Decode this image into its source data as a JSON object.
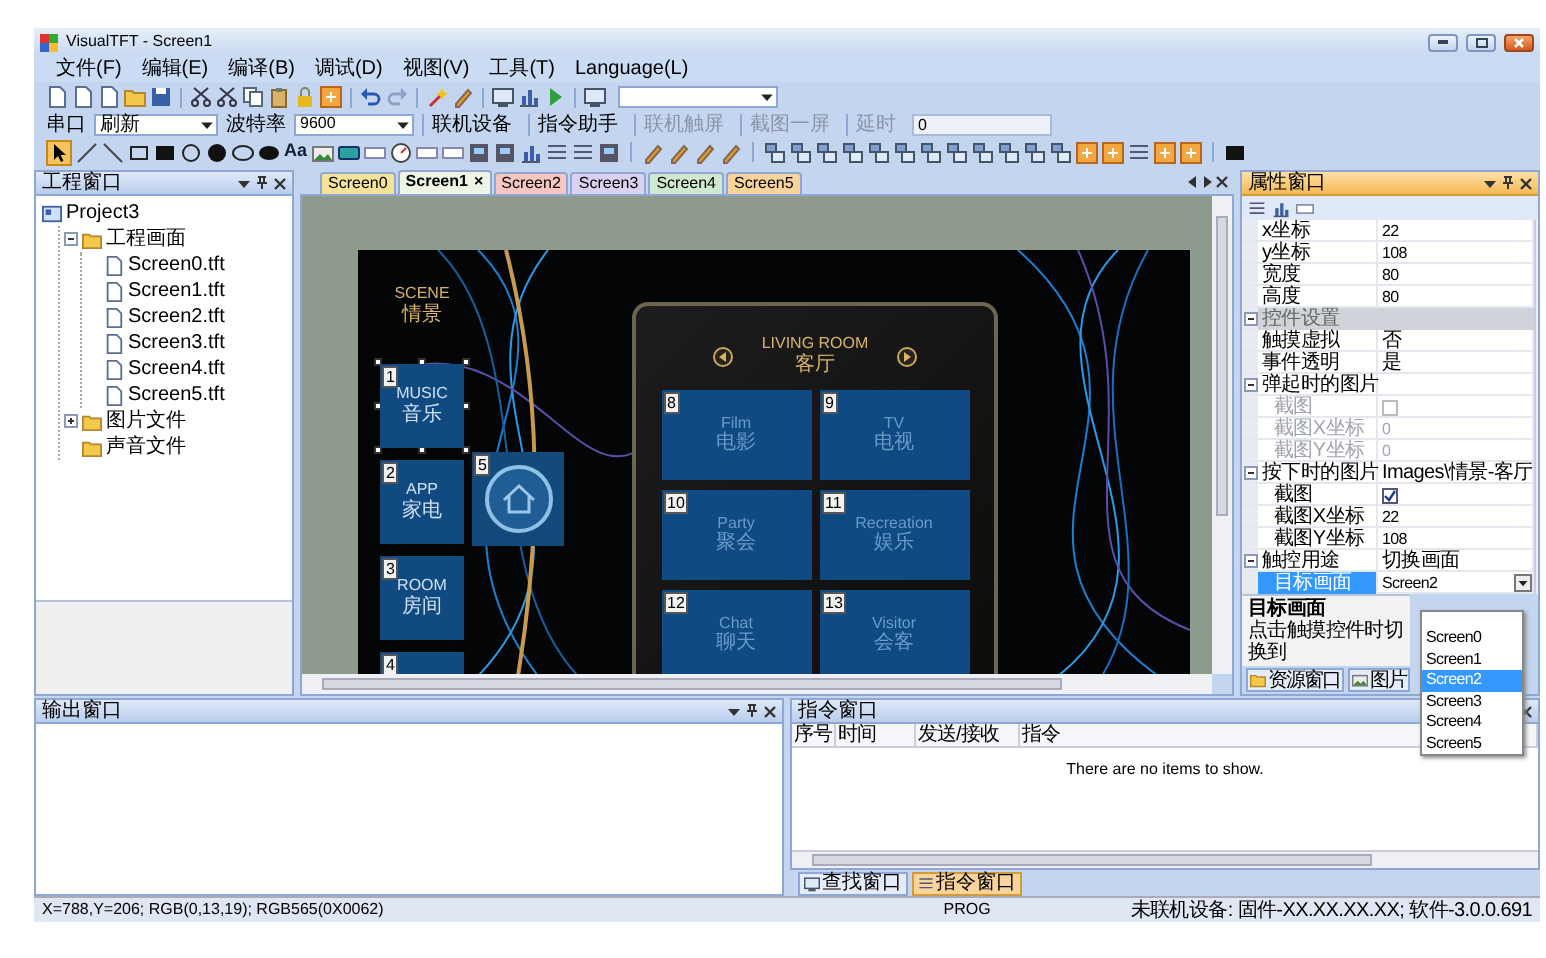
{
  "window": {
    "title": "VisualTFT - Screen1"
  },
  "menu": [
    "文件(F)",
    "编辑(E)",
    "编译(B)",
    "调试(D)",
    "视图(V)",
    "工具(T)",
    "Language(L)"
  ],
  "toolbar_2": {
    "port_label": "串口",
    "port_value": "刷新",
    "baud_label": "波特率",
    "baud_value": "9600",
    "buttons": [
      {
        "label": "联机设备",
        "disabled": false
      },
      {
        "label": "指令助手",
        "disabled": false
      },
      {
        "label": "联机触屏",
        "disabled": true
      },
      {
        "label": "截图一屏",
        "disabled": true
      }
    ],
    "delay_label": "延时",
    "delay_value": "0"
  },
  "toolbar_3": {
    "text_tool": "Aa"
  },
  "project_panel": {
    "title": "工程窗口",
    "tree": [
      {
        "label": "Project3",
        "children": [
          {
            "label": "工程画面",
            "expanded": true,
            "children": [
              {
                "label": "Screen0.tft"
              },
              {
                "label": "Screen1.tft"
              },
              {
                "label": "Screen2.tft"
              },
              {
                "label": "Screen3.tft"
              },
              {
                "label": "Screen4.tft"
              },
              {
                "label": "Screen5.tft"
              }
            ]
          },
          {
            "label": "图片文件",
            "expanded": false
          },
          {
            "label": "声音文件"
          }
        ]
      }
    ]
  },
  "editor": {
    "close_glyph": "×",
    "tabs": [
      {
        "label": "Screen0",
        "selected": false,
        "color": "#f6e39a"
      },
      {
        "label": "Screen1",
        "selected": true,
        "color": "#eef5e4"
      },
      {
        "label": "Screen2",
        "selected": false,
        "color": "#f7c6c0"
      },
      {
        "label": "Screen3",
        "selected": false,
        "color": "#dcd0f0"
      },
      {
        "label": "Screen4",
        "selected": false,
        "color": "#cfe8cf"
      },
      {
        "label": "Screen5",
        "selected": false,
        "color": "#f8d49a"
      }
    ]
  },
  "canvas": {
    "scene_title": "SCENE",
    "scene_subtitle": "情景",
    "left_tiles": [
      {
        "number": "1",
        "title": "MUSIC",
        "subtitle": "音乐",
        "selected": true
      },
      {
        "number": "2",
        "title": "APP",
        "subtitle": "家电",
        "selected": false
      },
      {
        "number": "3",
        "title": "ROOM",
        "subtitle": "房间",
        "selected": false
      },
      {
        "number": "4",
        "selected": false
      }
    ],
    "home_button": {
      "number": "5"
    },
    "room_title": "LIVING ROOM",
    "room_subtitle": "客厅",
    "room_tiles": [
      {
        "number": "8",
        "title": "Film",
        "subtitle": "电影"
      },
      {
        "number": "9",
        "title": "TV",
        "subtitle": "电视"
      },
      {
        "number": "10",
        "title": "Party",
        "subtitle": "聚会"
      },
      {
        "number": "11",
        "title": "Recreation",
        "subtitle": "娱乐"
      },
      {
        "number": "12",
        "title": "Chat",
        "subtitle": "聊天"
      },
      {
        "number": "13",
        "title": "Visitor",
        "subtitle": "会客"
      }
    ]
  },
  "properties": {
    "title": "属性窗口",
    "rows": [
      {
        "kind": "field",
        "name": "x坐标",
        "value": "22",
        "selected": false,
        "disabled": false
      },
      {
        "kind": "field",
        "name": "y坐标",
        "value": "108",
        "selected": false,
        "disabled": false
      },
      {
        "kind": "field",
        "name": "宽度",
        "value": "80",
        "selected": false,
        "disabled": false
      },
      {
        "kind": "field",
        "name": "高度",
        "value": "80",
        "selected": false,
        "disabled": false
      },
      {
        "kind": "section",
        "name": "控件设置",
        "expanded": true,
        "selected": false,
        "disabled": false
      },
      {
        "kind": "field",
        "name": "触摸虚拟",
        "value": "否",
        "selected": false,
        "disabled": false
      },
      {
        "kind": "field",
        "name": "事件透明",
        "value": "是",
        "selected": false,
        "disabled": false
      },
      {
        "kind": "parent",
        "name": "弹起时的图片",
        "expanded": true,
        "selected": false,
        "disabled": false
      },
      {
        "kind": "checkbox",
        "name": "截图",
        "checked": false,
        "selected": false,
        "disabled": true
      },
      {
        "kind": "child",
        "name": "截图X坐标",
        "value": "0",
        "selected": false,
        "disabled": true
      },
      {
        "kind": "child",
        "name": "截图Y坐标",
        "value": "0",
        "selected": false,
        "disabled": true
      },
      {
        "kind": "parent",
        "name": "按下时的图片",
        "value": "Images\\情景-客厅",
        "expanded": true,
        "selected": false,
        "disabled": false
      },
      {
        "kind": "checkbox",
        "name": "截图",
        "checked": true,
        "selected": false,
        "disabled": false
      },
      {
        "kind": "child",
        "name": "截图X坐标",
        "value": "22",
        "selected": false,
        "disabled": false
      },
      {
        "kind": "child",
        "name": "截图Y坐标",
        "value": "108",
        "selected": false,
        "disabled": false
      },
      {
        "kind": "parent",
        "name": "触控用途",
        "value": "切换画面",
        "expanded": true,
        "selected": false,
        "disabled": false
      },
      {
        "kind": "dropdown",
        "name": "目标画面",
        "value": "Screen2",
        "selected": true,
        "disabled": false
      }
    ],
    "dropdown_options": [
      {
        "label": "Screen0",
        "selected": false
      },
      {
        "label": "Screen1",
        "selected": false
      },
      {
        "label": "Screen2",
        "selected": true
      },
      {
        "label": "Screen3",
        "selected": false
      },
      {
        "label": "Screen4",
        "selected": false
      },
      {
        "label": "Screen5",
        "selected": false
      }
    ],
    "description_title": "目标画面",
    "description": "点击触摸控件时切换到",
    "tabs": [
      {
        "label": "资源窗口",
        "selected": false
      },
      {
        "label": "图片",
        "selected": false
      }
    ]
  },
  "output_panel": {
    "title": "输出窗口"
  },
  "command_panel": {
    "title": "指令窗口",
    "columns": [
      "序号",
      "时间",
      "发送/接收",
      "指令"
    ],
    "empty_text": "There are no items to show.",
    "tabs": [
      {
        "label": "查找窗口",
        "selected": false
      },
      {
        "label": "指令窗口",
        "selected": true
      }
    ]
  },
  "status_bar": {
    "coords": "X=788,Y=206; RGB(0,13,19); RGB565(0X0062)",
    "mode": "PROG",
    "device": "未联机设备: 固件-XX.XX.XX.XX; 软件-3.0.0.691"
  }
}
